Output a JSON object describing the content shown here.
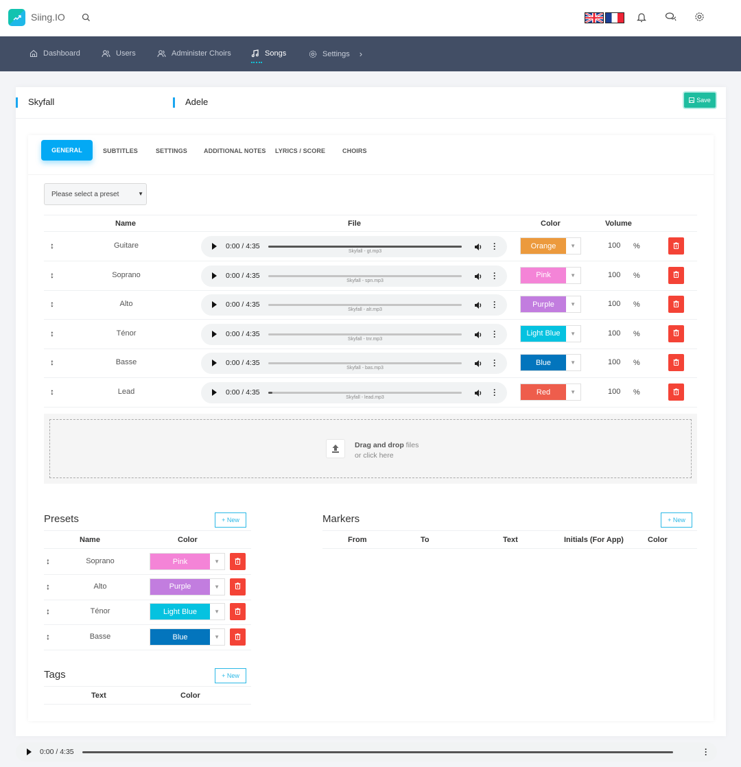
{
  "app": {
    "brand": "Siing.IO"
  },
  "topbar": {
    "languages": [
      "English",
      "Français"
    ]
  },
  "nav": {
    "items": [
      {
        "label": "Dashboard",
        "icon": "home-icon"
      },
      {
        "label": "Users",
        "icon": "users-icon"
      },
      {
        "label": "Administer Choirs",
        "icon": "users-icon"
      },
      {
        "label": "Songs",
        "icon": "music-note-icon",
        "active": true
      },
      {
        "label": "Settings",
        "icon": "gear-icon"
      }
    ]
  },
  "song": {
    "title": "Skyfall",
    "artist": "Adele",
    "save_label": "Save"
  },
  "tabs": [
    "GENERAL",
    "SUBTITLES",
    "SETTINGS",
    "ADDITIONAL NOTES",
    "LYRICS / SCORE",
    "CHOIRS"
  ],
  "preset_select": {
    "placeholder": "Please select a preset"
  },
  "tracks": {
    "headers": {
      "name": "Name",
      "file": "File",
      "color": "Color",
      "volume": "Volume"
    },
    "rows": [
      {
        "name": "Guitare",
        "time": "0:00 / 4:35",
        "file": "Skyfall - gt.mp3",
        "color": "Orange",
        "color_hex": "#ec9a3d",
        "volume": "100",
        "unit": "%",
        "progress": 100
      },
      {
        "name": "Soprano",
        "time": "0:00 / 4:35",
        "file": "Skyfall - spn.mp3",
        "color": "Pink",
        "color_hex": "#f484d7",
        "volume": "100",
        "unit": "%",
        "progress": 0
      },
      {
        "name": "Alto",
        "time": "0:00 / 4:35",
        "file": "Skyfall - alt.mp3",
        "color": "Purple",
        "color_hex": "#c27ddf",
        "volume": "100",
        "unit": "%",
        "progress": 0
      },
      {
        "name": "Ténor",
        "time": "0:00 / 4:35",
        "file": "Skyfall - tnr.mp3",
        "color": "Light Blue",
        "color_hex": "#05c2e0",
        "volume": "100",
        "unit": "%",
        "progress": 0
      },
      {
        "name": "Basse",
        "time": "0:00 / 4:35",
        "file": "Skyfall - bas.mp3",
        "color": "Blue",
        "color_hex": "#0375bd",
        "volume": "100",
        "unit": "%",
        "progress": 0
      },
      {
        "name": "Lead",
        "time": "0:00 / 4:35",
        "file": "Skyfall - lead.mp3",
        "color": "Red",
        "color_hex": "#ee5d4c",
        "volume": "100",
        "unit": "%",
        "progress": 2
      }
    ]
  },
  "dropzone": {
    "bold": "Drag and drop",
    "rest": " files",
    "line2": "or click here"
  },
  "presets": {
    "title": "Presets",
    "new_label": "+ New",
    "headers": {
      "name": "Name",
      "color": "Color"
    },
    "rows": [
      {
        "name": "Soprano",
        "color": "Pink",
        "color_hex": "#f484d7"
      },
      {
        "name": "Alto",
        "color": "Purple",
        "color_hex": "#c27ddf"
      },
      {
        "name": "Ténor",
        "color": "Light Blue",
        "color_hex": "#05c2e0"
      },
      {
        "name": "Basse",
        "color": "Blue",
        "color_hex": "#0375bd"
      }
    ]
  },
  "markers": {
    "title": "Markers",
    "new_label": "+ New",
    "headers": [
      "From",
      "To",
      "Text",
      "Initials (For App)",
      "Color"
    ]
  },
  "tags": {
    "title": "Tags",
    "new_label": "+ New",
    "headers": [
      "Text",
      "Color"
    ]
  },
  "bottom_player": {
    "time": "0:00 / 4:35"
  }
}
